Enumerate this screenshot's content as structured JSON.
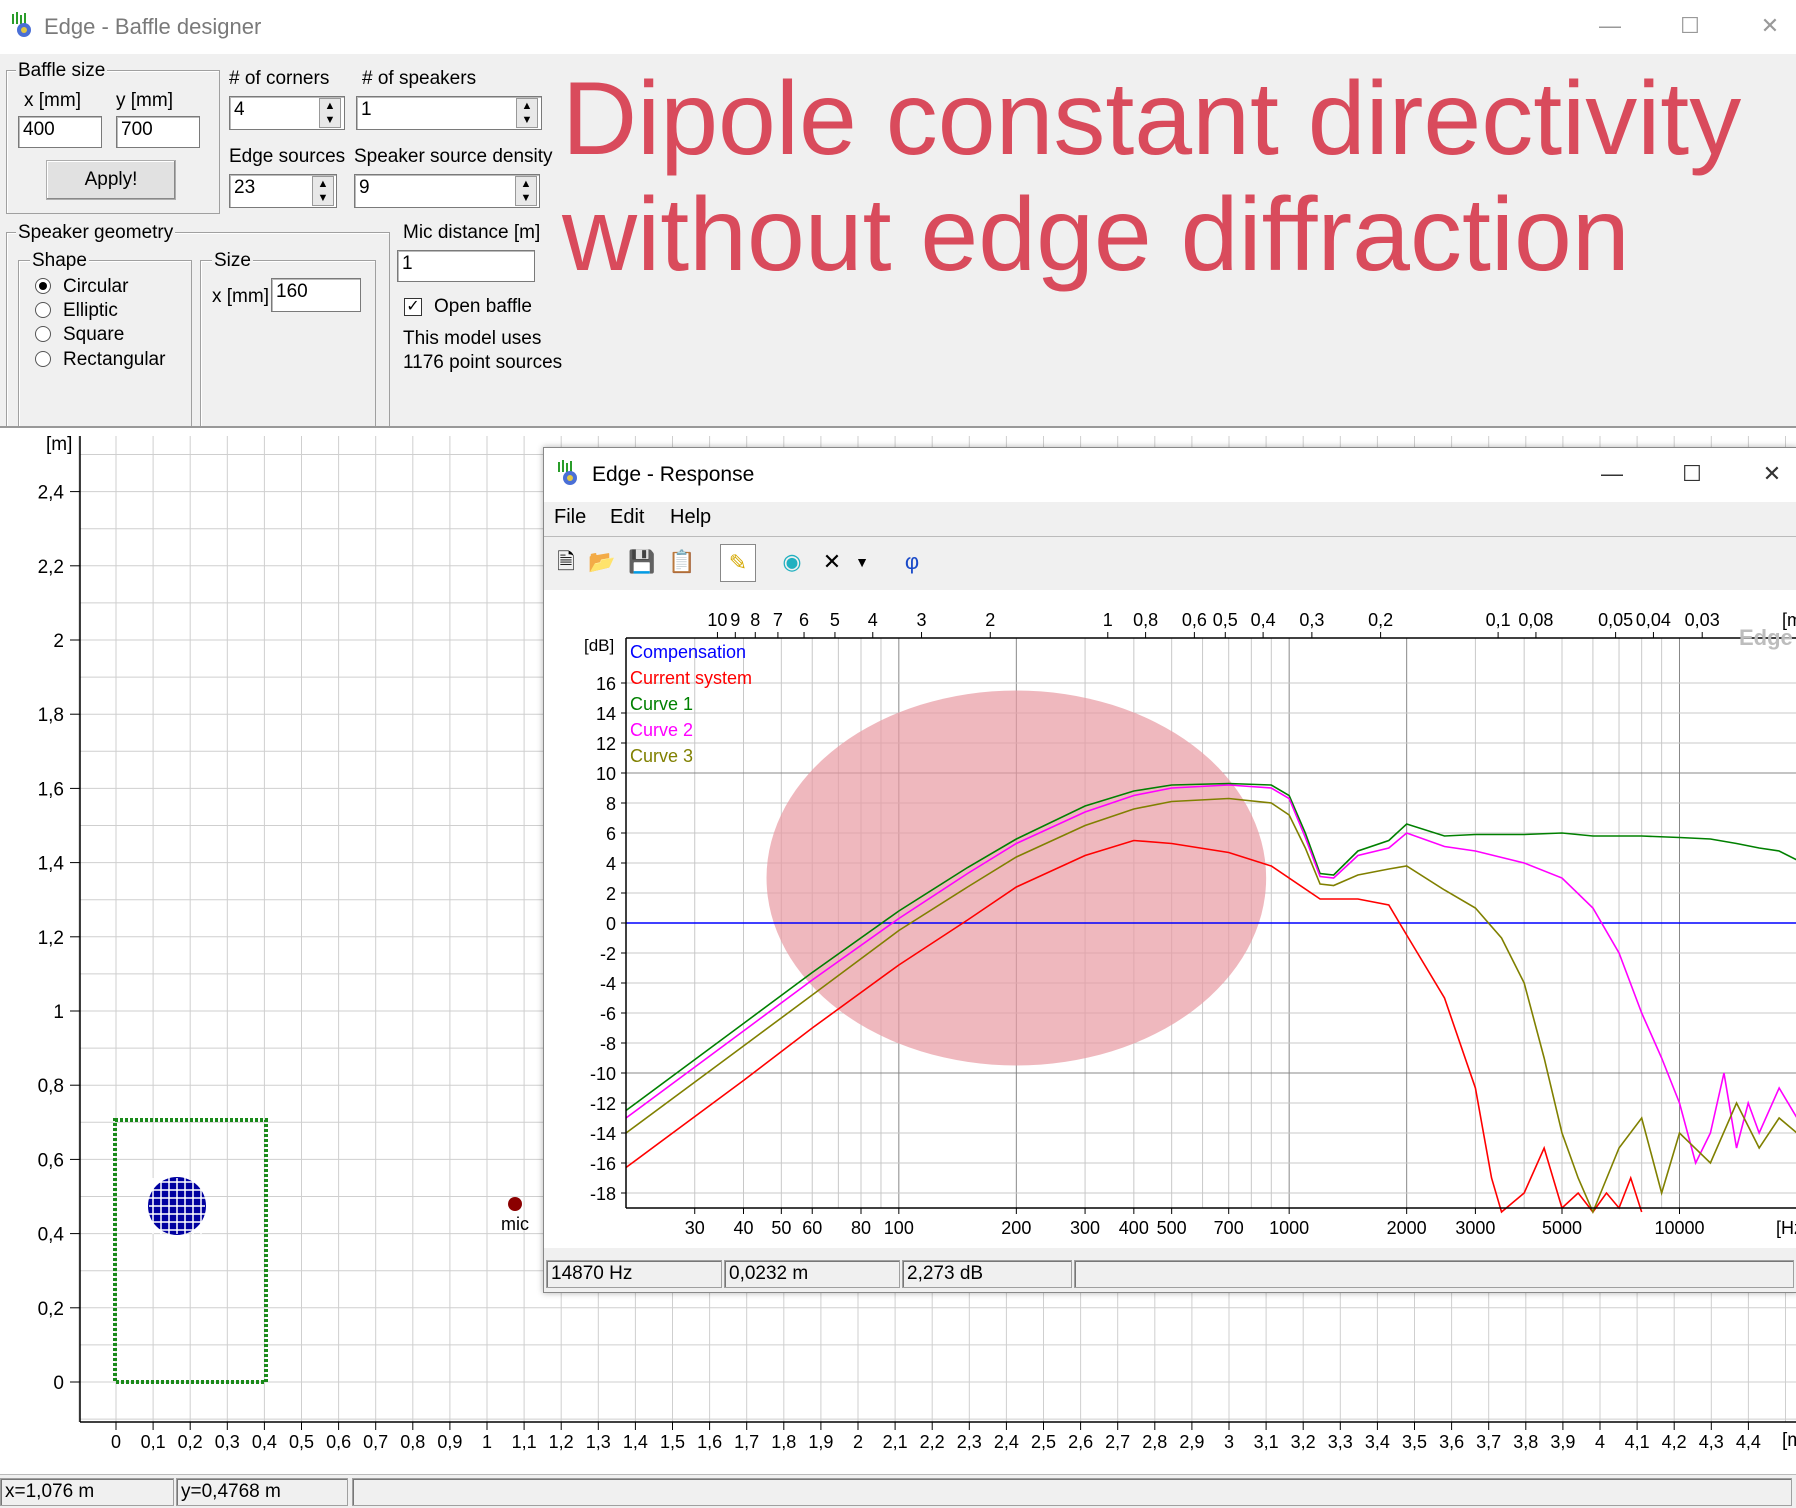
{
  "window": {
    "title": "Edge - Baffle designer"
  },
  "baffle_size": {
    "group": "Baffle size",
    "x_label": "x [mm]",
    "y_label": "y [mm]",
    "x_value": "400",
    "y_value": "700",
    "apply_label": "Apply!"
  },
  "corners": {
    "label": "# of corners",
    "value": "4"
  },
  "speakers": {
    "label": "# of speakers",
    "value": "1"
  },
  "edge_sources": {
    "label": "Edge sources",
    "value": "23"
  },
  "speaker_density": {
    "label": "Speaker source density",
    "value": "9"
  },
  "geometry": {
    "group": "Speaker geometry",
    "shape_group": "Shape",
    "shapes": [
      "Circular",
      "Elliptic",
      "Square",
      "Rectangular"
    ],
    "selected_shape": "Circular",
    "size_group": "Size",
    "x_label": "x [mm]",
    "x_value": "160"
  },
  "mic": {
    "label": "Mic distance [m]",
    "value": "1",
    "open_baffle_label": "Open baffle",
    "open_baffle_checked": true,
    "model_line1": "This model uses",
    "model_line2": "1176 point sources"
  },
  "headline": {
    "line1": "Dipole constant directivity",
    "line2": "without edge diffraction"
  },
  "layout_plot": {
    "y_unit": "[m]",
    "x_unit": "[m]",
    "y_ticks": [
      "2,4",
      "2,2",
      "2",
      "1,8",
      "1,6",
      "1,4",
      "1,2",
      "1",
      "0,8",
      "0,6",
      "0,4",
      "0,2",
      "0"
    ],
    "x_ticks": [
      "0",
      "0,1",
      "0,2",
      "0,3",
      "0,4",
      "0,5",
      "0,6",
      "0,7",
      "0,8",
      "0,9",
      "1",
      "1,1",
      "1,2",
      "1,3",
      "1,4",
      "1,5",
      "1,6",
      "1,7",
      "1,8",
      "1,9",
      "2",
      "2,1",
      "2,2",
      "2,3",
      "2,4",
      "2,5",
      "2,6",
      "2,7",
      "2,8",
      "2,9",
      "3",
      "3,1",
      "3,2",
      "3,3",
      "3,4",
      "3,5",
      "3,6",
      "3,7",
      "3,8",
      "3,9",
      "4",
      "4,1",
      "4,2",
      "4,3",
      "4,4"
    ],
    "mic_label": "mic"
  },
  "status": {
    "x": "x=1,076 m",
    "y": "y=0,4768 m"
  },
  "response": {
    "title": "Edge - Response",
    "menu": [
      "File",
      "Edit",
      "Help"
    ],
    "toolbar_icons": [
      "new-file-icon",
      "open-folder-icon",
      "save-icon",
      "copy-icon",
      "highlighter-icon",
      "speaker-icon",
      "delete-icon",
      "dropdown-arrow-icon",
      "phi-icon"
    ],
    "status": {
      "freq": "14870 Hz",
      "wavelength": "0,0232 m",
      "level": "2,273 dB"
    },
    "watermark": "Edge"
  },
  "chart_data": {
    "type": "line",
    "title": "",
    "xlabel": "[Hz]",
    "ylabel": "[dB]",
    "x_scale": "log",
    "xlim": [
      20,
      20000
    ],
    "ylim": [
      -19,
      19
    ],
    "x_ticks": [
      "30",
      "40",
      "50",
      "60",
      "80",
      "100",
      "200",
      "300",
      "400",
      "500",
      "700",
      "1000",
      "2000",
      "3000",
      "5000",
      "10000"
    ],
    "x_tick_values": [
      30,
      40,
      50,
      60,
      80,
      100,
      200,
      300,
      400,
      500,
      700,
      1000,
      2000,
      3000,
      5000,
      10000
    ],
    "y_ticks": [
      "16",
      "14",
      "12",
      "10",
      "8",
      "6",
      "4",
      "2",
      "0",
      "-2",
      "-4",
      "-6",
      "-8",
      "-10",
      "-12",
      "-14",
      "-16",
      "-18"
    ],
    "y_tick_values": [
      16,
      14,
      12,
      10,
      8,
      6,
      4,
      2,
      0,
      -2,
      -4,
      -6,
      -8,
      -10,
      -12,
      -14,
      -16,
      -18
    ],
    "top_axis_label": "[m]",
    "top_axis_ticks": [
      "10",
      "9",
      "8",
      "7",
      "6",
      "5",
      "4",
      "3",
      "2",
      "1",
      "0,8",
      "0,6",
      "0,5",
      "0,4",
      "0,3",
      "0,2",
      "0,1",
      "0,08",
      "0,05",
      "0,04",
      "0,03"
    ],
    "top_axis_values": [
      10,
      9,
      8,
      7,
      6,
      5,
      4,
      3,
      2,
      1,
      0.8,
      0.6,
      0.5,
      0.4,
      0.3,
      0.2,
      0.1,
      0.08,
      0.05,
      0.04,
      0.03
    ],
    "legend_position": "top-left",
    "grid": true,
    "highlight_ellipse": {
      "center_x": 200,
      "center_y": 3,
      "rx_decades": 0.64,
      "ry_db": 12.5,
      "color": "#e89aa3"
    },
    "series": [
      {
        "name": "Compensation",
        "color": "#0000ff",
        "x": [
          20,
          20000
        ],
        "y": [
          0,
          0
        ]
      },
      {
        "name": "Current system",
        "color": "#ff0000",
        "x": [
          20,
          40,
          60,
          100,
          150,
          200,
          300,
          400,
          500,
          700,
          900,
          1200,
          1500,
          1800,
          2000,
          2500,
          3000,
          3300,
          3500,
          4000,
          4500,
          5000,
          5500,
          6000,
          6500,
          7000,
          7500,
          8000
        ],
        "y": [
          -16.3,
          -10.5,
          -7.0,
          -2.8,
          0.2,
          2.4,
          4.5,
          5.5,
          5.3,
          4.7,
          3.8,
          1.6,
          1.6,
          1.2,
          -0.8,
          -5,
          -11,
          -17,
          -20,
          -18,
          -15,
          -19,
          -18,
          -20,
          -18,
          -19,
          -17,
          -20
        ]
      },
      {
        "name": "Curve 1",
        "color": "#008000",
        "x": [
          20,
          40,
          60,
          100,
          150,
          200,
          300,
          400,
          500,
          700,
          900,
          1000,
          1100,
          1200,
          1300,
          1500,
          1800,
          2000,
          2500,
          3000,
          4000,
          5000,
          6000,
          8000,
          10000,
          12000,
          14000,
          16000,
          18000,
          20000
        ],
        "y": [
          -12.5,
          -6.7,
          -3.3,
          0.8,
          3.7,
          5.6,
          7.8,
          8.8,
          9.2,
          9.3,
          9.2,
          8.5,
          6.0,
          3.3,
          3.2,
          4.8,
          5.5,
          6.6,
          5.8,
          5.9,
          5.9,
          6.0,
          5.8,
          5.8,
          5.7,
          5.6,
          5.3,
          5.0,
          4.8,
          4.2
        ]
      },
      {
        "name": "Curve 2",
        "color": "#ff00ff",
        "x": [
          20,
          40,
          60,
          100,
          150,
          200,
          300,
          400,
          500,
          700,
          900,
          1000,
          1100,
          1200,
          1300,
          1500,
          1800,
          2000,
          2500,
          3000,
          4000,
          5000,
          6000,
          7000,
          8000,
          9000,
          10000,
          11000,
          12000,
          13000,
          14000,
          15000,
          16000,
          18000,
          20000
        ],
        "y": [
          -13,
          -7.2,
          -3.8,
          0.3,
          3.3,
          5.3,
          7.4,
          8.5,
          9.0,
          9.2,
          9.0,
          8.3,
          5.7,
          3.1,
          3.0,
          4.5,
          5.0,
          6.0,
          5.1,
          4.8,
          4.0,
          3.0,
          1.0,
          -2.0,
          -6.0,
          -9.0,
          -12,
          -16,
          -14,
          -10,
          -15,
          -12,
          -14,
          -11,
          -13
        ]
      },
      {
        "name": "Curve 3",
        "color": "#808000",
        "x": [
          20,
          40,
          60,
          100,
          150,
          200,
          300,
          400,
          500,
          700,
          900,
          1000,
          1100,
          1200,
          1300,
          1500,
          1800,
          2000,
          2500,
          3000,
          3500,
          4000,
          4500,
          5000,
          5500,
          6000,
          7000,
          8000,
          9000,
          10000,
          12000,
          14000,
          16000,
          18000,
          20000
        ],
        "y": [
          -14,
          -8.2,
          -4.8,
          -0.5,
          2.4,
          4.4,
          6.5,
          7.6,
          8.1,
          8.3,
          8.0,
          7.2,
          5.0,
          2.6,
          2.5,
          3.2,
          3.6,
          3.8,
          2.2,
          1.0,
          -1.0,
          -4,
          -9,
          -14,
          -17,
          -20,
          -15,
          -13,
          -18,
          -14,
          -16,
          -12,
          -15,
          -13,
          -14
        ]
      }
    ]
  }
}
